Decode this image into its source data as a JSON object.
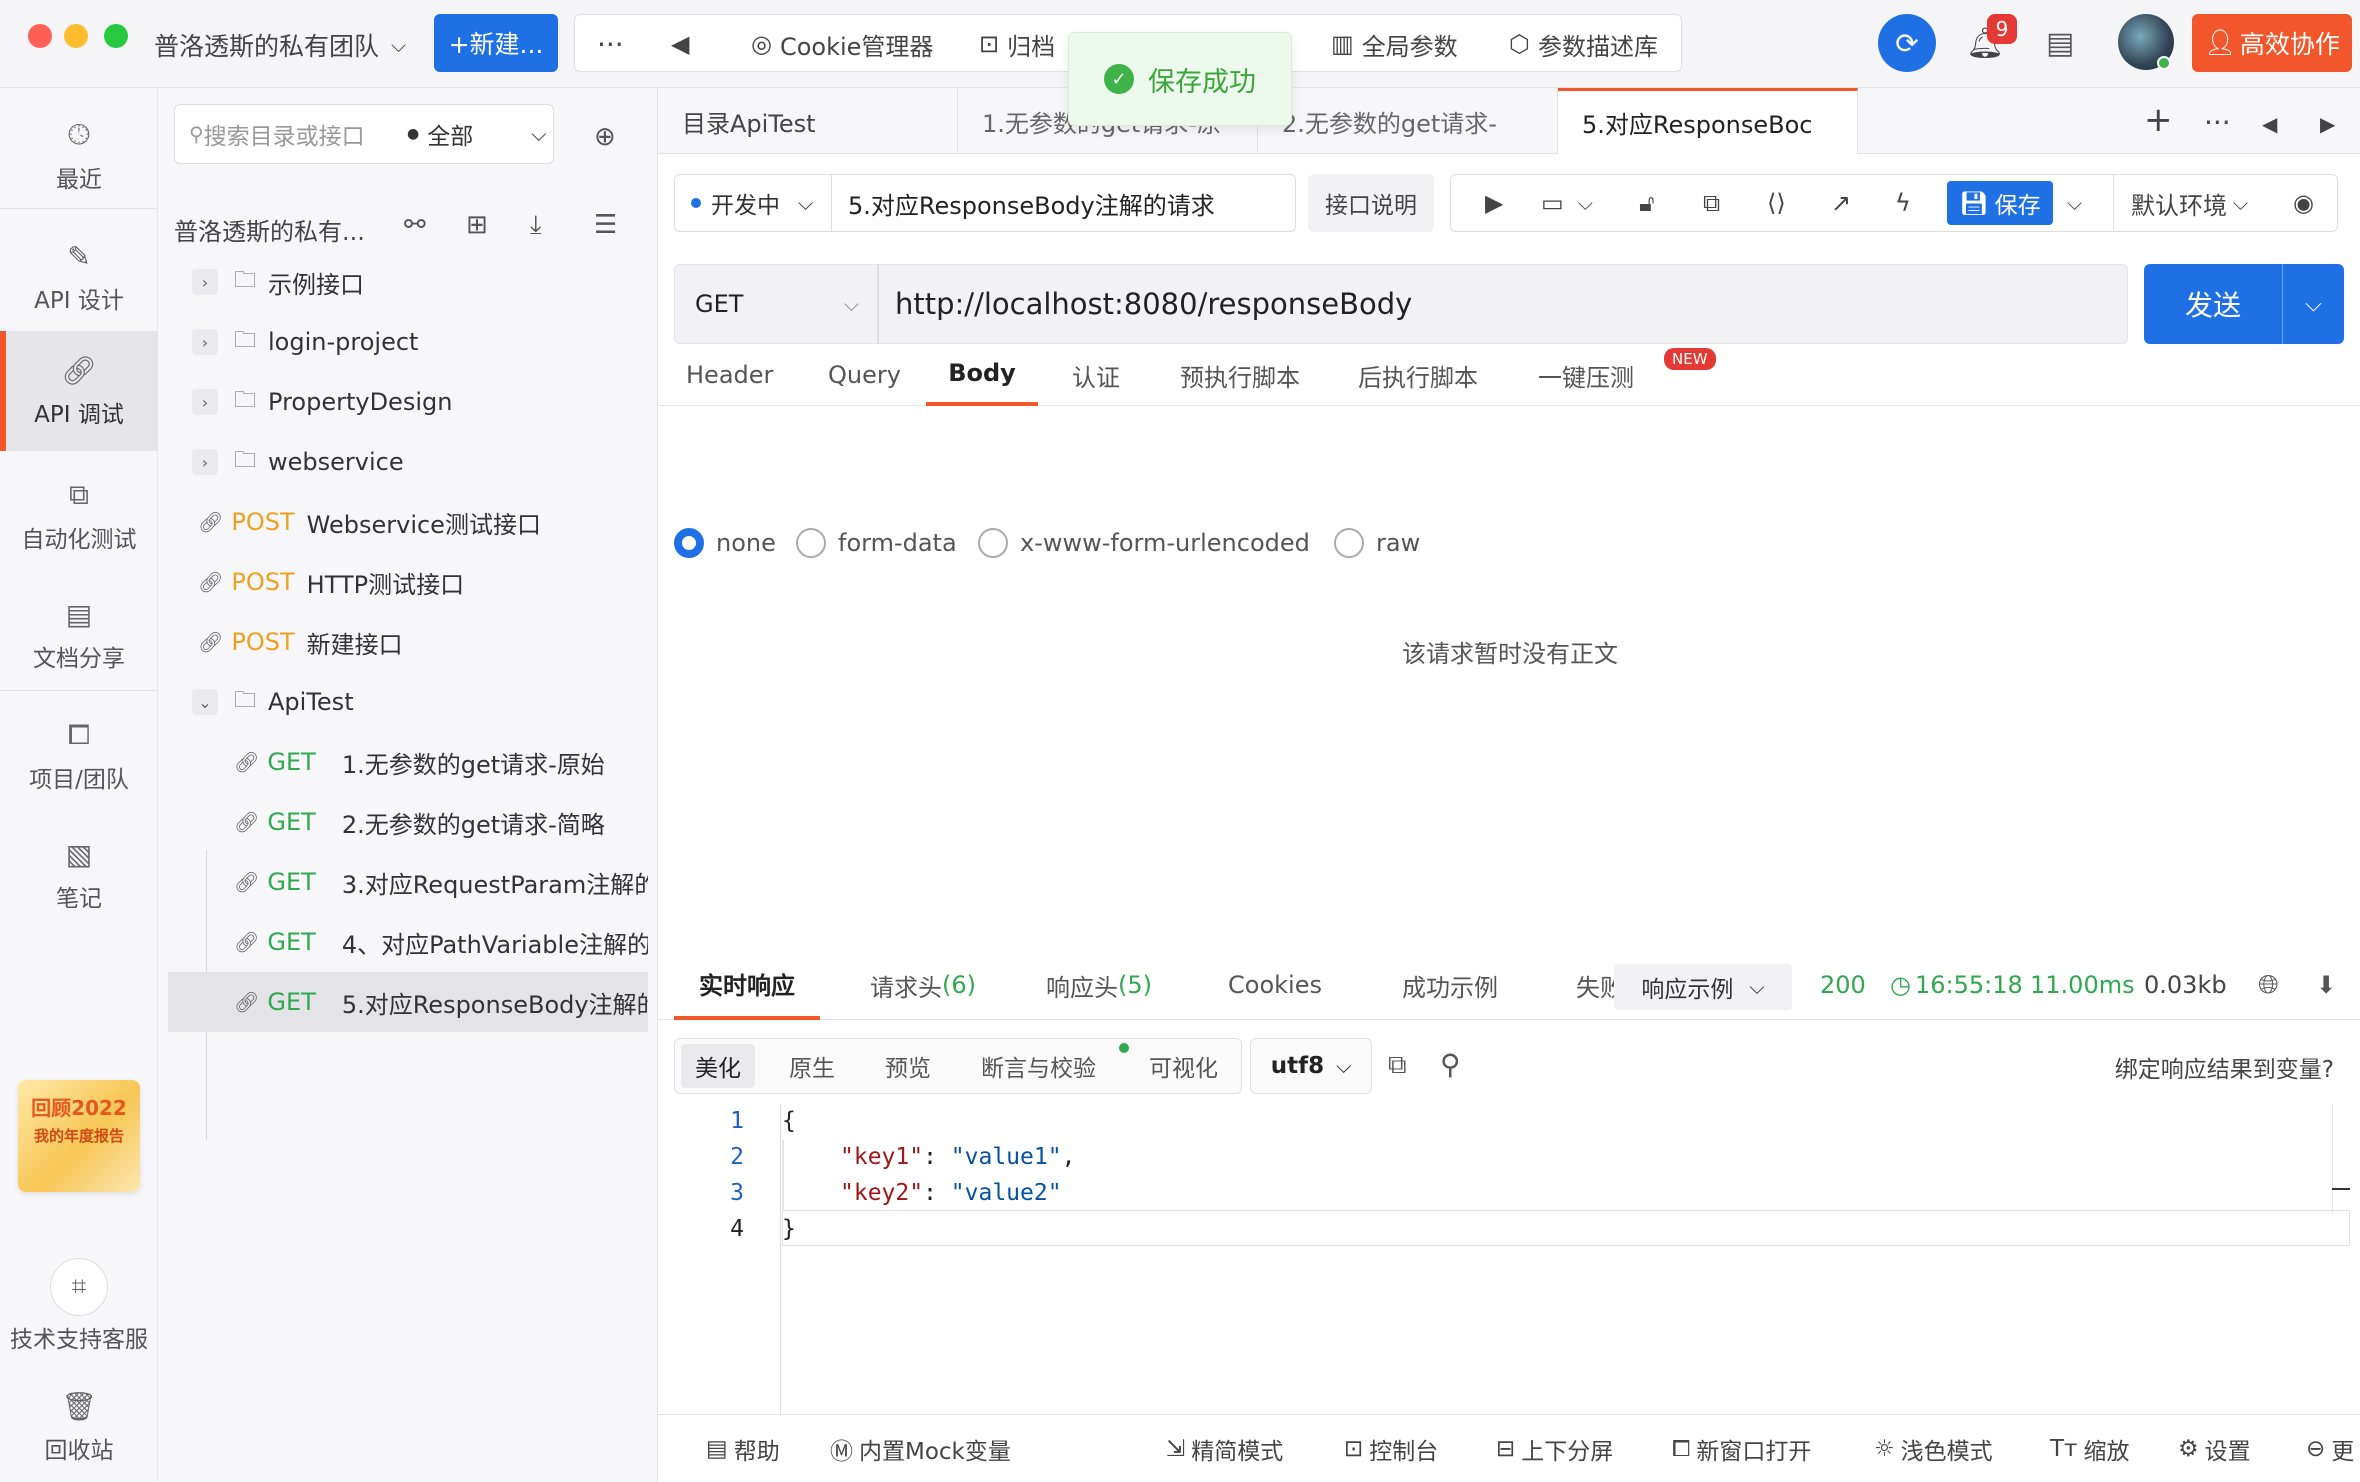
{
  "topbar": {
    "team_name": "普洛透斯的私有团队",
    "new_label": "+新建...",
    "tools": [
      {
        "icon": "cookie-icon",
        "label": "Cookie管理器"
      },
      {
        "icon": "archive-icon",
        "label": "归档"
      },
      {
        "icon": "global-params-icon",
        "label": "全局参数"
      },
      {
        "icon": "cube-icon",
        "label": "参数描述库"
      }
    ],
    "toast": "保存成功",
    "notification_count": "9",
    "collab_label": "高效协作"
  },
  "leftnav": {
    "items": [
      "最近",
      "API 设计",
      "API 调试",
      "自动化测试",
      "文档分享",
      "项目/团队",
      "笔记",
      "技术支持客服",
      "回收站"
    ],
    "year_badge": {
      "title": "回顾2022",
      "subtitle": "我的年度报告"
    },
    "accent": "#f2562b"
  },
  "tree": {
    "search_placeholder": "搜索目录或接口",
    "filter": "全部",
    "project_title": "普洛透斯的私有...",
    "folders": [
      "示例接口",
      "login-project",
      "PropertyDesign",
      "webservice"
    ],
    "posts": [
      {
        "method": "POST",
        "name": "Webservice测试接口"
      },
      {
        "method": "POST",
        "name": "HTTP测试接口"
      },
      {
        "method": "POST",
        "name": "新建接口"
      }
    ],
    "open_folder": "ApiTest",
    "gets": [
      {
        "method": "GET",
        "name": "1.无参数的get请求-原始"
      },
      {
        "method": "GET",
        "name": "2.无参数的get请求-简略"
      },
      {
        "method": "GET",
        "name": "3.对应RequestParam注解的"
      },
      {
        "method": "GET",
        "name": "4、对应PathVariable注解的"
      },
      {
        "method": "GET",
        "name": "5.对应ResponseBody注解的"
      }
    ]
  },
  "tabs": [
    "目录ApiTest",
    "1.无参数的get请求-原",
    "2.无参数的get请求-",
    "5.对应ResponseBoc"
  ],
  "request": {
    "status": "开发中",
    "name": "5.对应ResponseBody注解的请求",
    "doc_label": "接口说明",
    "save_label": "保存",
    "env": "默认环境",
    "method": "GET",
    "url": "http://localhost:8080/responseBody",
    "send_label": "发送",
    "tabs": [
      "Header",
      "Query",
      "Body",
      "认证",
      "预执行脚本",
      "后执行脚本",
      "一键压测"
    ],
    "new_tag": "NEW",
    "body_types": [
      "none",
      "form-data",
      "x-www-form-urlencoded",
      "raw"
    ],
    "no_body": "该请求暂时没有正文"
  },
  "response": {
    "tabs": [
      "实时响应",
      "请求头",
      "(6)",
      "响应头",
      "(5)",
      "Cookies",
      "成功示例",
      "失败"
    ],
    "example_label": "响应示例",
    "status_code": "200",
    "time": "16:55:18",
    "duration": "11.00ms",
    "size": "0.03kb",
    "view_tabs": [
      "美化",
      "原生",
      "预览",
      "断言与校验",
      "可视化"
    ],
    "encoding": "utf8",
    "bind_label": "绑定响应结果到变量?",
    "lines": [
      "1",
      "2",
      "3",
      "4"
    ],
    "code": {
      "open": "{",
      "key1": "\"key1\"",
      "val1": "\"value1\"",
      "key2": "\"key2\"",
      "val2": "\"value2\"",
      "close": "}"
    }
  },
  "footer": [
    "帮助",
    "内置Mock变量",
    "精简模式",
    "控制台",
    "上下分屏",
    "新窗口打开",
    "浅色模式",
    "缩放",
    "设置",
    "更"
  ]
}
